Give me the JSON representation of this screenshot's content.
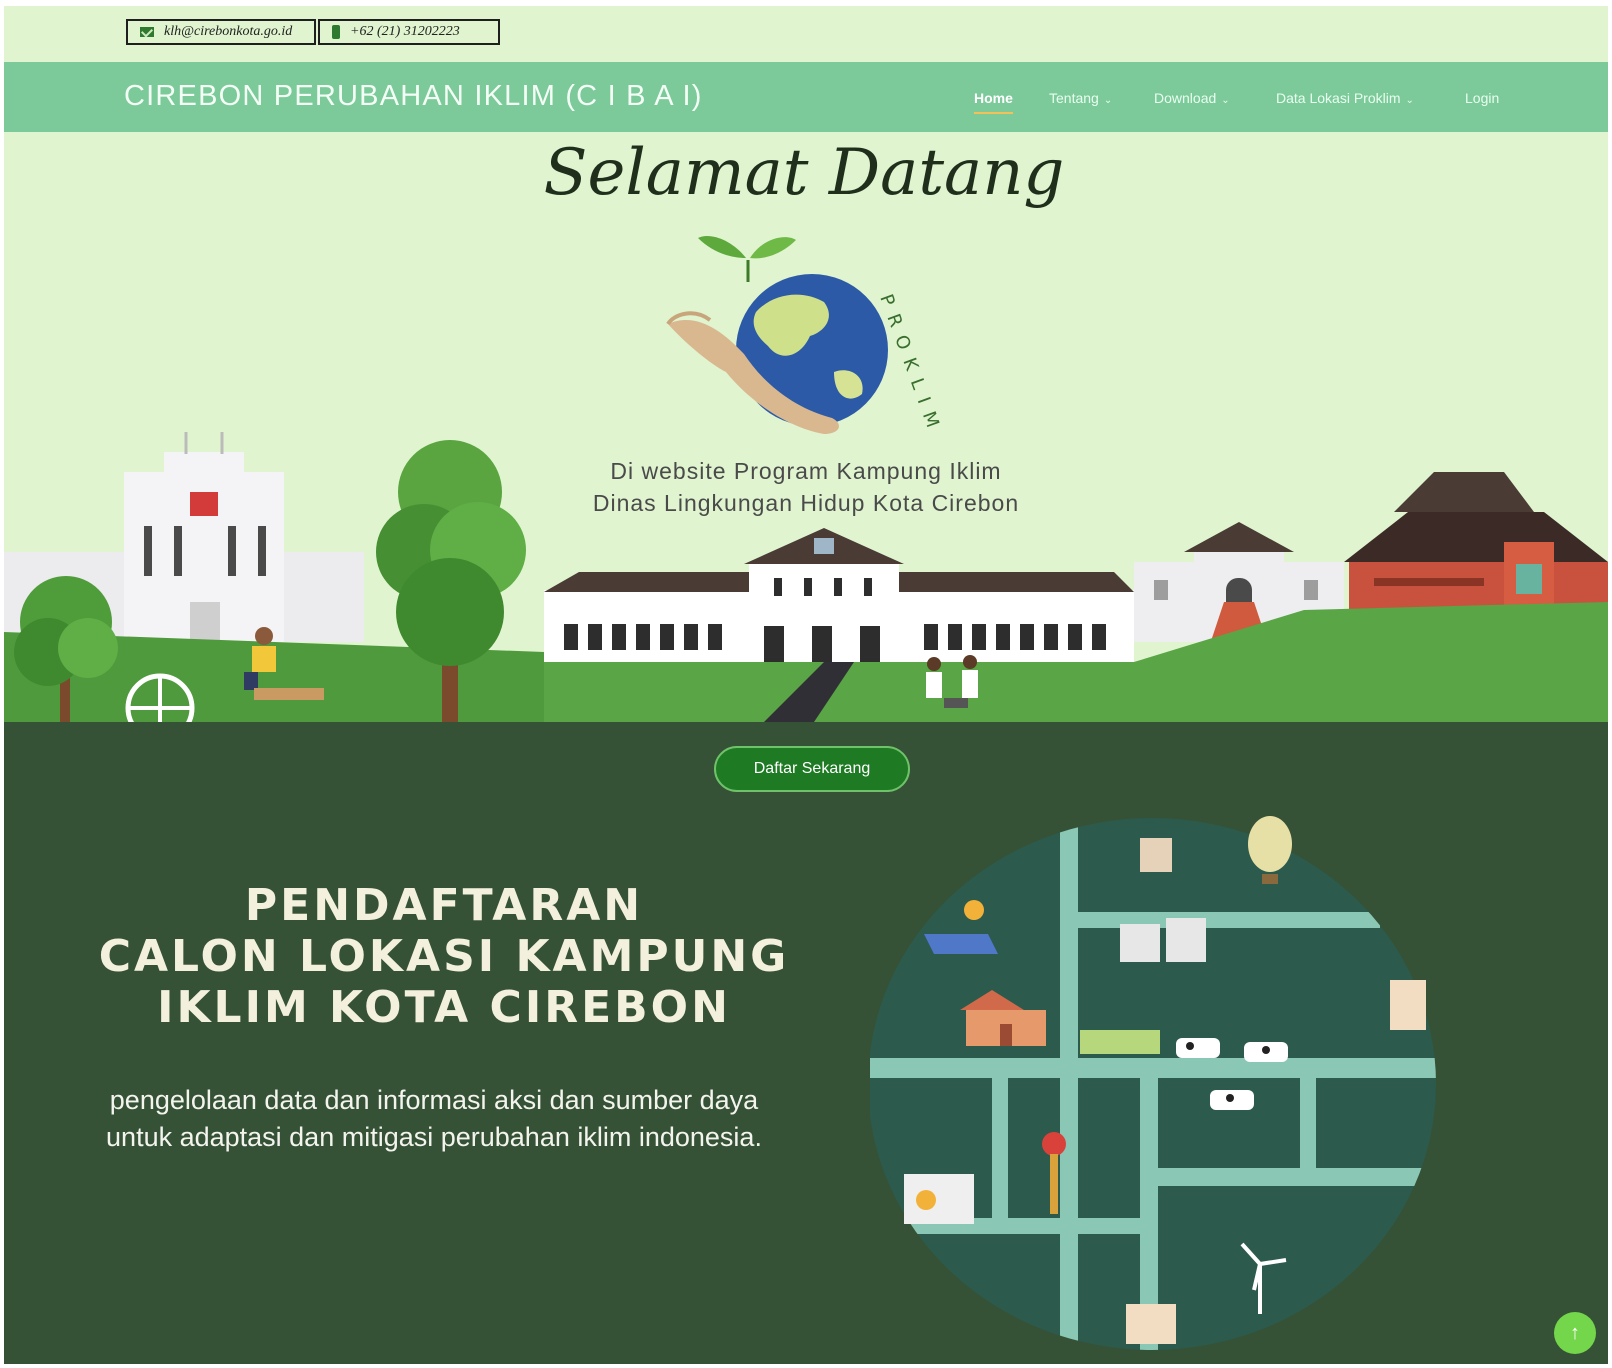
{
  "topbar": {
    "email": "klh@cirebonkota.go.id",
    "phone": "+62 (21) 31202223"
  },
  "navbar": {
    "brand": "CIREBON PERUBAHAN IKLIM (C I B A I)",
    "items": [
      {
        "label": "Home",
        "active": true
      },
      {
        "label": "Tentang",
        "dropdown": true
      },
      {
        "label": "Download",
        "dropdown": true
      },
      {
        "label": "Data Lokasi Proklim",
        "dropdown": true
      },
      {
        "label": "Login"
      }
    ]
  },
  "hero": {
    "welcome": "Selamat Datang",
    "logo_text": "PROKLIM",
    "line1": "Di website Program Kampung Iklim",
    "line2": "Dinas Lingkungan Hidup Kota Cirebon"
  },
  "cta": {
    "label": "Daftar Sekarang"
  },
  "registration": {
    "title_line1": "PENDAFTARAN",
    "title_line2": "CALON LOKASI KAMPUNG",
    "title_line3": "IKLIM KOTA CIREBON",
    "description": "pengelolaan data dan informasi aksi dan sumber daya untuk adaptasi dan mitigasi perubahan iklim indonesia."
  },
  "icons": {
    "email": "mail-icon",
    "phone": "phone-icon",
    "chevron": "chevron-down-icon",
    "scroll_top": "arrow-up-icon"
  },
  "colors": {
    "page_bg": "#dff4cf",
    "navbar": "#7cc99a",
    "dark_section": "#365236",
    "cta": "#1f7a24",
    "scroll_top": "#74d64a",
    "map_bg": "#2c5a4c"
  }
}
